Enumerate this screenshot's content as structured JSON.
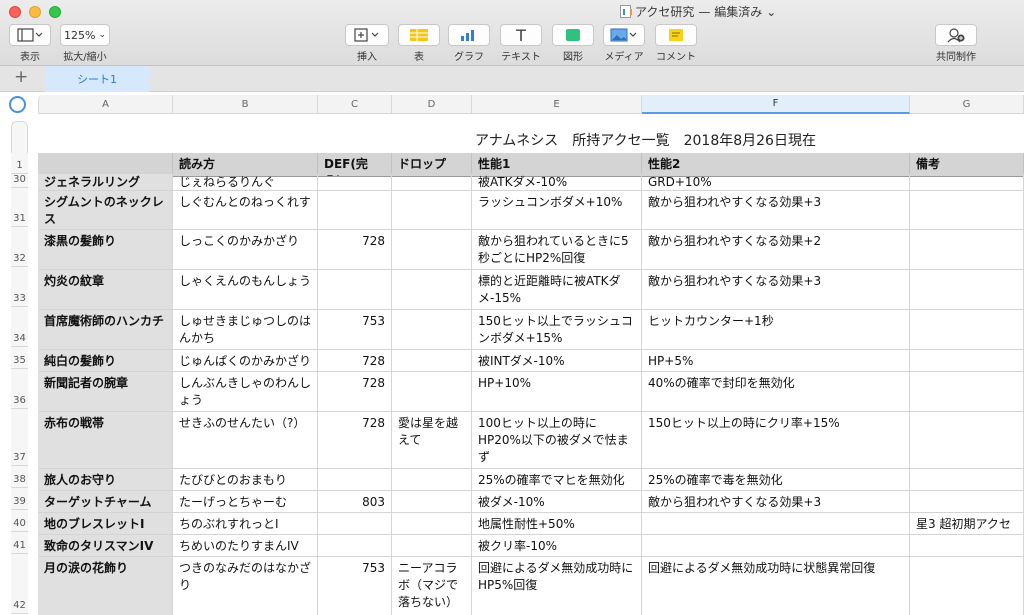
{
  "window": {
    "document_title": "アクセ研究",
    "status": "— 編集済み",
    "title_chevron": "⌄"
  },
  "toolbar": {
    "view_label": "表示",
    "zoom_value": "125%",
    "zoom_label": "拡大/縮小",
    "insert_label": "挿入",
    "table_label": "表",
    "chart_label": "グラフ",
    "text_label": "テキスト",
    "shape_label": "図形",
    "media_label": "メディア",
    "comment_label": "コメント",
    "collaborate_label": "共同制作",
    "text_glyph": "T"
  },
  "tabs": {
    "add": "+",
    "sheets": [
      "シート1"
    ]
  },
  "columns": [
    "A",
    "B",
    "C",
    "D",
    "E",
    "F",
    "G"
  ],
  "sheet": {
    "title": "アナムネシス　所持アクセ一覧　2018年8月26日現在",
    "header_row_number": "1",
    "headers": [
      "",
      "読み方",
      "DEF(完凸)",
      "ドロップ",
      "性能1",
      "性能2",
      "備考"
    ],
    "rows": [
      {
        "n": "30",
        "cells": [
          "ジェネラルリング",
          "じぇねらるりんぐ",
          "",
          "",
          "被ATKダメ-10%",
          "GRD+10%",
          ""
        ]
      },
      {
        "n": "31",
        "cells": [
          "シグムントのネックレス",
          "しぐむんとのねっくれす",
          "",
          "",
          "ラッシュコンボダメ+10%",
          "敵から狙われやすくなる効果+3",
          ""
        ]
      },
      {
        "n": "32",
        "cells": [
          "漆黒の髪飾り",
          "しっこくのかみかざり",
          "728",
          "",
          "敵から狙われているときに5秒ごとにHP2%回復",
          "敵から狙われやすくなる効果+2",
          ""
        ]
      },
      {
        "n": "33",
        "cells": [
          "灼炎の紋章",
          "しゃくえんのもんしょう",
          "",
          "",
          "標的と近距離時に被ATKダメ-15%",
          "敵から狙われやすくなる効果+3",
          ""
        ]
      },
      {
        "n": "34",
        "cells": [
          "首席魔術師のハンカチ",
          "しゅせきまじゅつしのはんかち",
          "753",
          "",
          "150ヒット以上でラッシュコンボダメ+15%",
          "ヒットカウンター+1秒",
          ""
        ]
      },
      {
        "n": "35",
        "cells": [
          "純白の髪飾り",
          "じゅんぱくのかみかざり",
          "728",
          "",
          "被INTダメ-10%",
          "HP+5%",
          ""
        ]
      },
      {
        "n": "36",
        "cells": [
          "新聞記者の腕章",
          "しんぶんきしゃのわんしょう",
          "728",
          "",
          "HP+10%",
          "40%の確率で封印を無効化",
          ""
        ]
      },
      {
        "n": "37",
        "cells": [
          "赤布の戦帯",
          "せきふのせんたい（?）",
          "728",
          "愛は星を越えて",
          "100ヒット以上の時にHP20%以下の被ダメで怯まず",
          "150ヒット以上の時にクリ率+15%",
          ""
        ]
      },
      {
        "n": "38",
        "cells": [
          "旅人のお守り",
          "たびびとのおまもり",
          "",
          "",
          "25%の確率でマヒを無効化",
          "25%の確率で毒を無効化",
          ""
        ]
      },
      {
        "n": "39",
        "cells": [
          "ターゲットチャーム",
          "たーげっとちゃーむ",
          "803",
          "",
          "被ダメ-10%",
          "敵から狙われやすくなる効果+3",
          ""
        ]
      },
      {
        "n": "40",
        "cells": [
          "地のブレスレットI",
          "ちのぶれすれっとI",
          "",
          "",
          "地属性耐性+50%",
          "",
          "星3 超初期アクセ"
        ]
      },
      {
        "n": "41",
        "cells": [
          "致命のタリスマンIV",
          "ちめいのたりすまんIV",
          "",
          "",
          "被クリ率-10%",
          "",
          ""
        ]
      },
      {
        "n": "42",
        "cells": [
          "月の涙の花飾り",
          "つきのなみだのはなかざり",
          "753",
          "ニーアコラボ（マジで落ちない）",
          "回避によるダメ無効成功時にHP5%回復",
          "回避によるダメ無効成功時に状態異常回復",
          ""
        ]
      }
    ]
  }
}
